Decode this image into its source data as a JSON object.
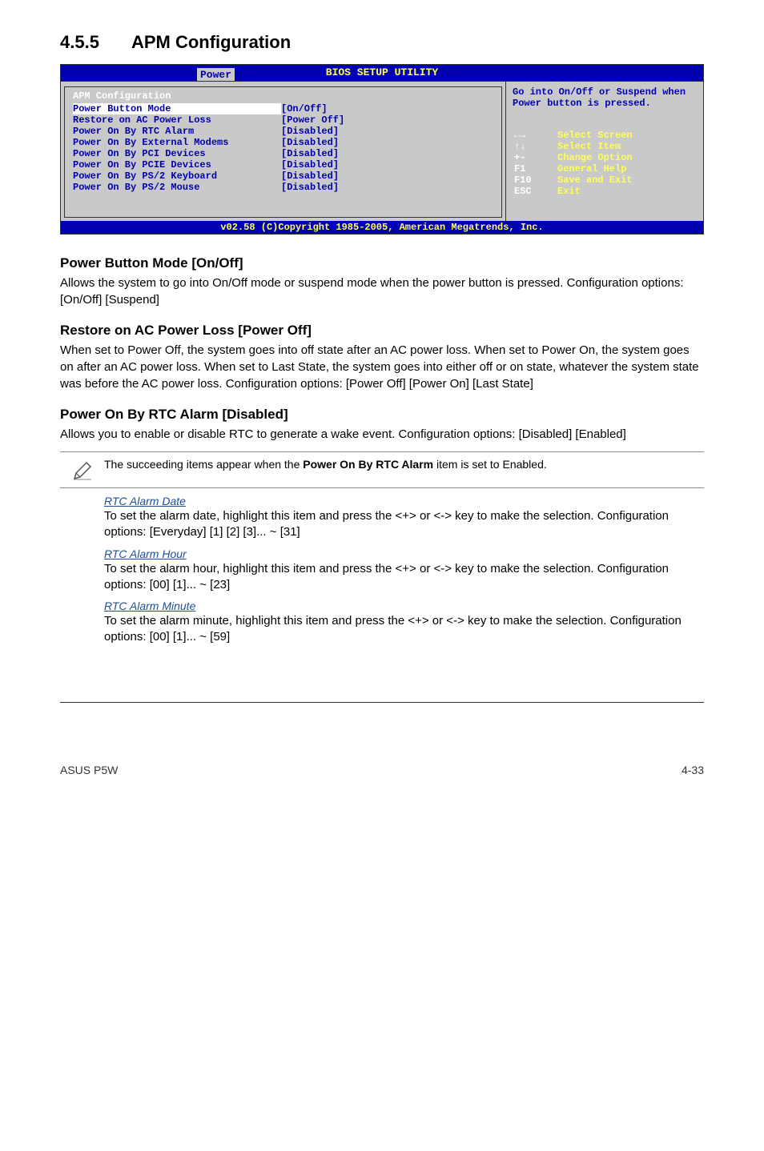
{
  "heading": {
    "num": "4.5.5",
    "title": "APM Configuration"
  },
  "bios": {
    "title": "BIOS SETUP UTILITY",
    "tab": "Power",
    "section_title": "APM Configuration",
    "rows": [
      {
        "label": "Power Button Mode",
        "val": "[On/Off]"
      },
      {
        "label": "",
        "val": ""
      },
      {
        "label": "Restore on AC Power Loss",
        "val": "[Power Off]"
      },
      {
        "label": "Power On By RTC Alarm",
        "val": "[Disabled]"
      },
      {
        "label": "Power On By External Modems",
        "val": "[Disabled]"
      },
      {
        "label": "Power On By PCI Devices",
        "val": "[Disabled]"
      },
      {
        "label": "Power On By PCIE Devices",
        "val": "[Disabled]"
      },
      {
        "label": "Power On By PS/2 Keyboard",
        "val": "[Disabled]"
      },
      {
        "label": "Power On By PS/2 Mouse",
        "val": "[Disabled]"
      }
    ],
    "help": "Go into On/Off or Suspend when Power button is pressed.",
    "nav": [
      {
        "key": "←→",
        "desc": "Select Screen"
      },
      {
        "key": "↑↓",
        "desc": "Select Item"
      },
      {
        "key": "+-",
        "desc": "Change Option"
      },
      {
        "key": "F1",
        "desc": "General Help"
      },
      {
        "key": "F10",
        "desc": "Save and Exit"
      },
      {
        "key": "ESC",
        "desc": "Exit"
      }
    ],
    "footer": "v02.58 (C)Copyright 1985-2005, American Megatrends, Inc."
  },
  "s1": {
    "head": "Power Button Mode [On/Off]",
    "para": "Allows the system to go into On/Off mode or suspend mode when the power button is pressed. Configuration options: [On/Off] [Suspend]"
  },
  "s2": {
    "head": "Restore on AC Power Loss [Power Off]",
    "para": "When set to Power Off, the system goes into off state after an AC power loss. When set to Power On, the system goes on after an AC power loss. When set to Last State, the system goes into either off or on state, whatever the system state was before the AC power loss. Configuration options: [Power Off] [Power On] [Last State]"
  },
  "s3": {
    "head": "Power On By RTC Alarm [Disabled]",
    "para": "Allows you to enable or disable RTC to generate a wake event. Configuration options: [Disabled] [Enabled]"
  },
  "note": {
    "pre": "The succeeding items appear when the ",
    "bold": "Power On By RTC Alarm",
    "post": " item is set to Enabled."
  },
  "rtc": [
    {
      "head": "RTC Alarm Date",
      "para": "To set the alarm date, highlight this item and press the <+> or <-> key to make the selection. Configuration options: [Everyday] [1] [2] [3]... ~ [31]"
    },
    {
      "head": "RTC Alarm Hour",
      "para": "To set the alarm hour, highlight this item and press the <+> or <-> key to make the selection. Configuration options: [00] [1]... ~ [23]"
    },
    {
      "head": "RTC Alarm Minute",
      "para": "To set the alarm minute, highlight this item and press the <+> or <-> key to make the selection. Configuration options: [00] [1]... ~ [59]"
    }
  ],
  "footer": {
    "left": "ASUS P5W",
    "right": "4-33"
  }
}
